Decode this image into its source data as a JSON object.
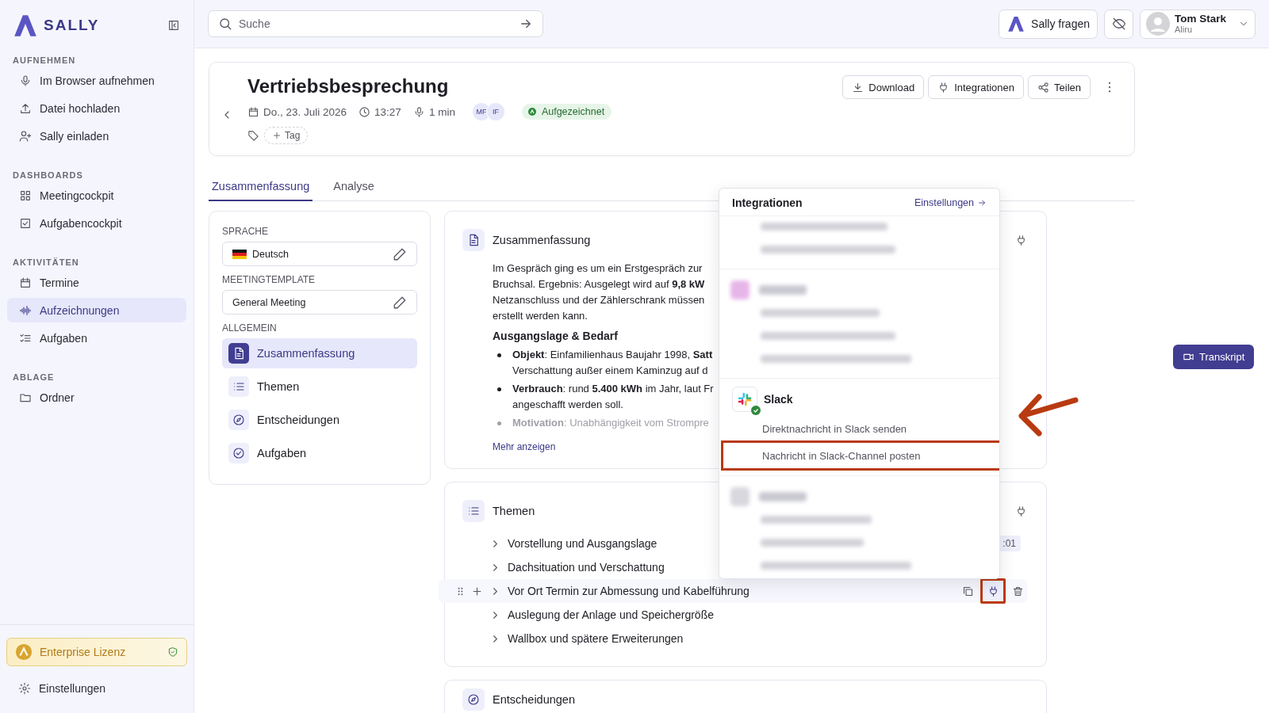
{
  "sidebar": {
    "brand": "SALLY",
    "sections": [
      {
        "title": "AUFNEHMEN",
        "items": [
          {
            "label": "Im Browser aufnehmen",
            "selected": false
          },
          {
            "label": "Datei hochladen",
            "selected": false
          },
          {
            "label": "Sally einladen",
            "selected": false
          }
        ]
      },
      {
        "title": "DASHBOARDS",
        "items": [
          {
            "label": "Meetingcockpit",
            "selected": false
          },
          {
            "label": "Aufgabencockpit",
            "selected": false
          }
        ]
      },
      {
        "title": "AKTIVITÄTEN",
        "items": [
          {
            "label": "Termine",
            "selected": false
          },
          {
            "label": "Aufzeichnungen",
            "selected": true
          },
          {
            "label": "Aufgaben",
            "selected": false
          }
        ]
      },
      {
        "title": "ABLAGE",
        "items": [
          {
            "label": "Ordner",
            "selected": false
          }
        ]
      }
    ],
    "license": "Enterprise Lizenz",
    "settings": "Einstellungen"
  },
  "topbar": {
    "search": {
      "placeholder": "Suche"
    },
    "ask_button": "Sally fragen",
    "user": {
      "name": "Tom Stark",
      "org": "Aliru"
    }
  },
  "meeting": {
    "title": "Vertriebsbesprechung",
    "date": "Do., 23. Juli 2026",
    "time": "13:27",
    "duration": "1 min",
    "participants": [
      "MF",
      "IF"
    ],
    "status": "Aufgezeichnet",
    "tag_button": "Tag",
    "actions": [
      "Download",
      "Integrationen",
      "Teilen"
    ]
  },
  "tabs": [
    {
      "label": "Zusammenfassung",
      "selected": true
    },
    {
      "label": "Analyse",
      "selected": false
    }
  ],
  "settings_panel": {
    "language_label": "SPRACHE",
    "language": "Deutsch",
    "template_label": "MEETINGTEMPLATE",
    "template": "General Meeting",
    "section_label": "ALLGEMEIN",
    "items": [
      {
        "label": "Zusammenfassung",
        "selected": true
      },
      {
        "label": "Themen",
        "selected": false
      },
      {
        "label": "Entscheidungen",
        "selected": false
      },
      {
        "label": "Aufgaben",
        "selected": false
      }
    ]
  },
  "summary_card": {
    "title": "Zusammenfassung",
    "paragraph": [
      "Im Gespräch ging es um ein Erstgespräch zur",
      "Bruchsal. Ergebnis: Ausgelegt wird auf **9,8 kW**",
      "Netzanschluss und der Zählerschrank müssen",
      "erstellt werden kann."
    ],
    "heading": "Ausgangslage & Bedarf",
    "bullets": [
      {
        "lines": [
          "**Objekt**: Einfamilienhaus Baujahr 1998, **Satt**",
          "Verschattung außer einem Kaminzug auf d"
        ],
        "faded": false
      },
      {
        "lines": [
          "**Verbrauch**: rund **5.400 kWh** im Jahr, laut Fr",
          "angeschafft werden soll."
        ],
        "faded": false
      },
      {
        "lines": [
          "**Motivation**: Unabhängigkeit vom Strompre"
        ],
        "faded": true
      }
    ],
    "more_link": "Mehr anzeigen"
  },
  "topics_card": {
    "title": "Themen",
    "items": [
      {
        "label": "Vorstellung und Ausgangslage",
        "time": ":01",
        "hovered": false
      },
      {
        "label": "Dachsituation und Verschattung",
        "hovered": false
      },
      {
        "label": "Vor Ort Termin zur Abmessung und Kabelführung",
        "hovered": true,
        "plug_highlighted": true
      },
      {
        "label": "Auslegung der Anlage und Speichergröße",
        "hovered": false
      },
      {
        "label": "Wallbox und spätere Erweiterungen",
        "hovered": false
      }
    ]
  },
  "decisions_card": {
    "title": "Entscheidungen"
  },
  "integrations_popup": {
    "title": "Integrationen",
    "settings_link": "Einstellungen",
    "groups": [
      {
        "kind": "blurred"
      },
      {
        "kind": "blurred"
      },
      {
        "kind": "app",
        "name": "Slack",
        "connected": true,
        "actions": [
          {
            "label": "Direktnachricht in Slack senden",
            "highlighted": false
          },
          {
            "label": "Nachricht in Slack-Channel posten",
            "highlighted": true
          }
        ]
      },
      {
        "kind": "blurred"
      }
    ]
  },
  "transcript_button": "Transkript"
}
